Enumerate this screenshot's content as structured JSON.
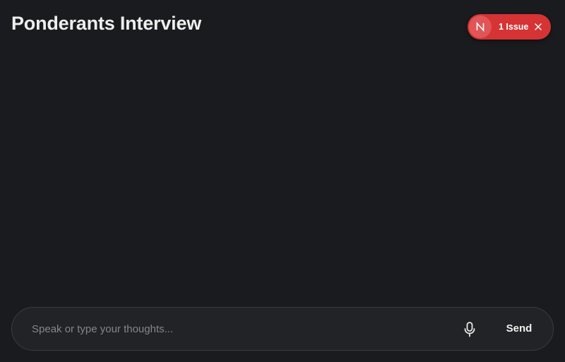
{
  "header": {
    "title": "Ponderants Interview"
  },
  "issues_badge": {
    "logo_letter": "N",
    "label": "1 Issue",
    "color": "#d53334",
    "logo_icon": "nextjs-logo-icon",
    "close_icon": "close-icon"
  },
  "composer": {
    "input_value": "",
    "placeholder": "Speak or type your thoughts...",
    "mic_icon": "microphone-icon",
    "send_label": "Send"
  },
  "colors": {
    "background": "#1a1b1e",
    "composer_background": "#222326",
    "composer_border": "#3b3c40",
    "title_text": "#eeeeee"
  }
}
